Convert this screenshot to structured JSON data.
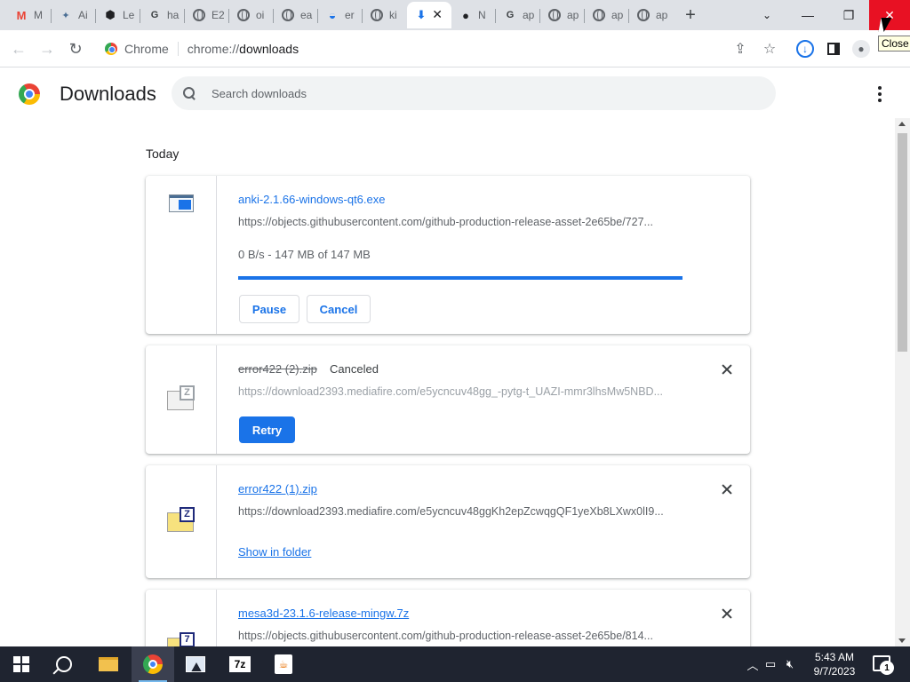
{
  "browser": {
    "tabs": [
      {
        "title": "M",
        "icon": "gmail-icon"
      },
      {
        "title": "Ai",
        "icon": "puzzle-icon"
      },
      {
        "title": "Le",
        "icon": "shield-icon"
      },
      {
        "title": "ha",
        "icon": "google-icon"
      },
      {
        "title": "E2",
        "icon": "globe-icon"
      },
      {
        "title": "oi",
        "icon": "globe-icon"
      },
      {
        "title": "ea",
        "icon": "globe-icon"
      },
      {
        "title": "er",
        "icon": "edge-icon"
      },
      {
        "title": "ki",
        "icon": "globe-icon"
      },
      {
        "title": "",
        "icon": "download-icon",
        "active": true
      },
      {
        "title": "N",
        "icon": "github-icon"
      },
      {
        "title": "ap",
        "icon": "google-icon"
      },
      {
        "title": "ap",
        "icon": "globe-icon"
      },
      {
        "title": "ap",
        "icon": "globe-icon"
      },
      {
        "title": "ap",
        "icon": "globe-icon"
      }
    ],
    "window_tooltip": "Close",
    "omnibox": {
      "site_label": "Chrome",
      "url_scheme": "chrome://",
      "url_path": "downloads"
    }
  },
  "downloads_page": {
    "title": "Downloads",
    "search_placeholder": "Search downloads",
    "date_group": "Today",
    "items": [
      {
        "filename": "anki-2.1.66-windows-qt6.exe",
        "url": "https://objects.githubusercontent.com/github-production-release-asset-2e65be/727...",
        "progress_text": "0 B/s - 147 MB of 147 MB",
        "progress_fraction": 1.0,
        "buttons": {
          "pause": "Pause",
          "cancel": "Cancel"
        },
        "file_icon": "exe-icon"
      },
      {
        "filename": "error422 (2).zip",
        "status": "Canceled",
        "url": "https://download2393.mediafire.com/e5ycncuv48gg_-pytg-t_UAZI-mmr3lhsMw5NBD...",
        "buttons": {
          "retry": "Retry"
        },
        "file_icon": "zip-icon"
      },
      {
        "filename": "error422 (1).zip",
        "url": "https://download2393.mediafire.com/e5ycncuv48ggKh2epZcwqgQF1yeXb8LXwx0lI9...",
        "link": "Show in folder",
        "file_icon": "zip-icon"
      },
      {
        "filename": "mesa3d-23.1.6-release-mingw.7z",
        "url": "https://objects.githubusercontent.com/github-production-release-asset-2e65be/814...",
        "file_icon": "7z-icon"
      }
    ]
  },
  "taskbar": {
    "clock_time": "5:43 AM",
    "clock_date": "9/7/2023",
    "notification_count": "1",
    "sevenzip_label": "7z"
  },
  "colors": {
    "accent": "#1a73e8",
    "close_red": "#e81123",
    "tabstrip": "#dee1e6",
    "taskbar": "#1f2430"
  }
}
